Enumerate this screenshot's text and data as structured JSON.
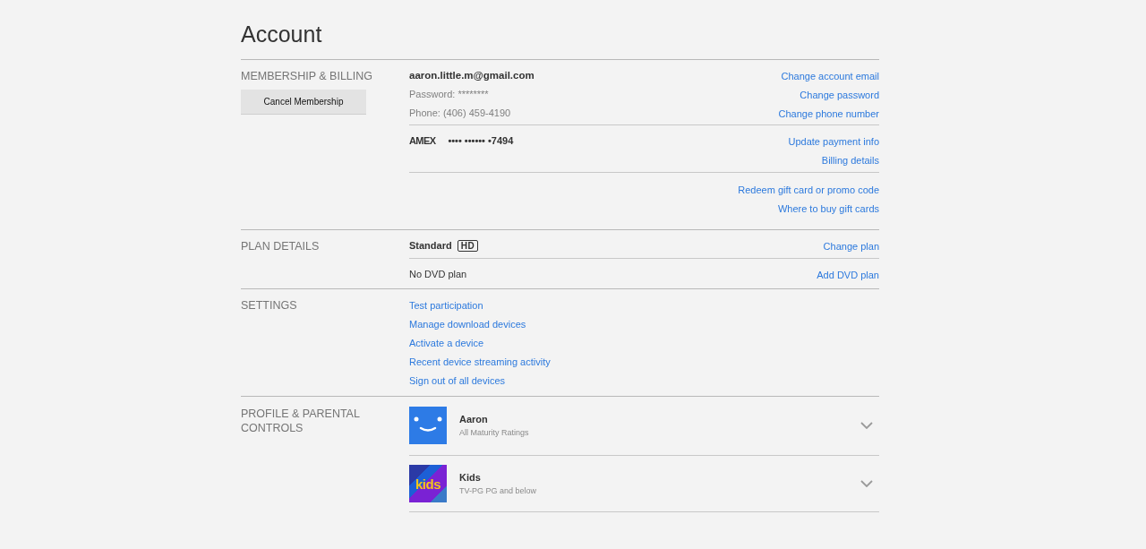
{
  "page": {
    "title": "Account"
  },
  "membership": {
    "heading": "MEMBERSHIP & BILLING",
    "cancel_button": "Cancel Membership",
    "groups": [
      {
        "rows": [
          {
            "kind": "email",
            "text": "aaron.little.m@gmail.com",
            "link": "Change account email"
          },
          {
            "kind": "detail",
            "text": "Password: ********",
            "link": "Change password"
          },
          {
            "kind": "detail",
            "text": "Phone: (406) 459-4190",
            "link": "Change phone number"
          }
        ]
      },
      {
        "rows": [
          {
            "kind": "card",
            "brand": "AMEX",
            "text": "•••• •••••• •7494",
            "link": "Update payment info"
          },
          {
            "kind": "link_only",
            "link": "Billing details"
          }
        ]
      },
      {
        "rows": [
          {
            "kind": "link_only",
            "link": "Redeem gift card or promo code"
          },
          {
            "kind": "link_only",
            "link": "Where to buy gift cards"
          }
        ]
      }
    ]
  },
  "plan": {
    "heading": "PLAN DETAILS",
    "rows": [
      {
        "kind": "streaming",
        "text": "Standard",
        "badge": "HD",
        "link": "Change plan"
      },
      {
        "kind": "dvd",
        "text": "No DVD plan",
        "link": "Add DVD plan"
      }
    ]
  },
  "settings": {
    "heading": "SETTINGS",
    "links": [
      "Test participation",
      "Manage download devices",
      "Activate a device",
      "Recent device streaming activity",
      "Sign out of all devices"
    ]
  },
  "profiles": {
    "heading": "PROFILE & PARENTAL CONTROLS",
    "items": [
      {
        "kind": "smiley",
        "name": "Aaron",
        "rating": "All Maturity Ratings",
        "expanded": false
      },
      {
        "kind": "kids",
        "avatar_text": "kids",
        "name": "Kids",
        "rating": "TV-PG PG and below",
        "expanded": false
      }
    ]
  }
}
